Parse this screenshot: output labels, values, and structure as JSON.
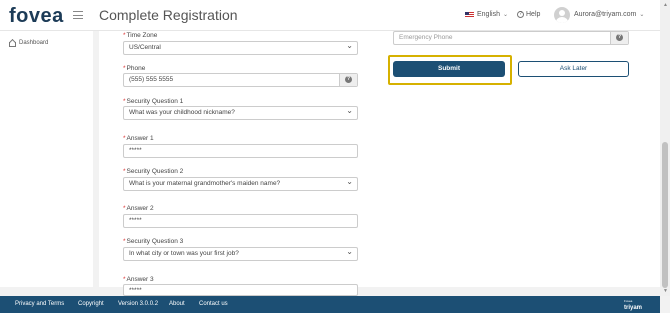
{
  "header": {
    "logo": "fovea",
    "title": "Complete Registration",
    "language": "English",
    "help": "Help",
    "user": "Aurora@triyam.com"
  },
  "sidebar": {
    "items": [
      {
        "label": "Dashboard",
        "icon": "home-icon"
      }
    ]
  },
  "form": {
    "time_zone": {
      "label": "Time Zone",
      "value": "US/Central"
    },
    "phone": {
      "label": "Phone",
      "value": "(555) 555 5555"
    },
    "security_q1": {
      "label": "Security Question 1",
      "value": "What was your childhood nickname?"
    },
    "answer1": {
      "label": "Answer 1",
      "value": "*****"
    },
    "security_q2": {
      "label": "Security Question 2",
      "value": "What is your maternal grandmother's maiden name?"
    },
    "answer2": {
      "label": "Answer 2",
      "value": "*****"
    },
    "security_q3": {
      "label": "Security Question 3",
      "value": "In what city or town was your first job?"
    },
    "answer3": {
      "label": "Answer 3",
      "value": "*****"
    },
    "emergency_phone": {
      "placeholder": "Emergency Phone"
    },
    "required_marker": "*",
    "help_glyph": "?"
  },
  "actions": {
    "submit": "Submit",
    "ask_later": "Ask Later"
  },
  "footer": {
    "links": [
      "Privacy and Terms",
      "Copyright",
      "Version 3.0.0.2",
      "About",
      "Contact us"
    ],
    "brand": "triyam",
    "brand_tagline": "Fovea"
  },
  "colors": {
    "primary": "#1c4f74",
    "highlight": "#d6b100",
    "required": "#dd3333"
  }
}
